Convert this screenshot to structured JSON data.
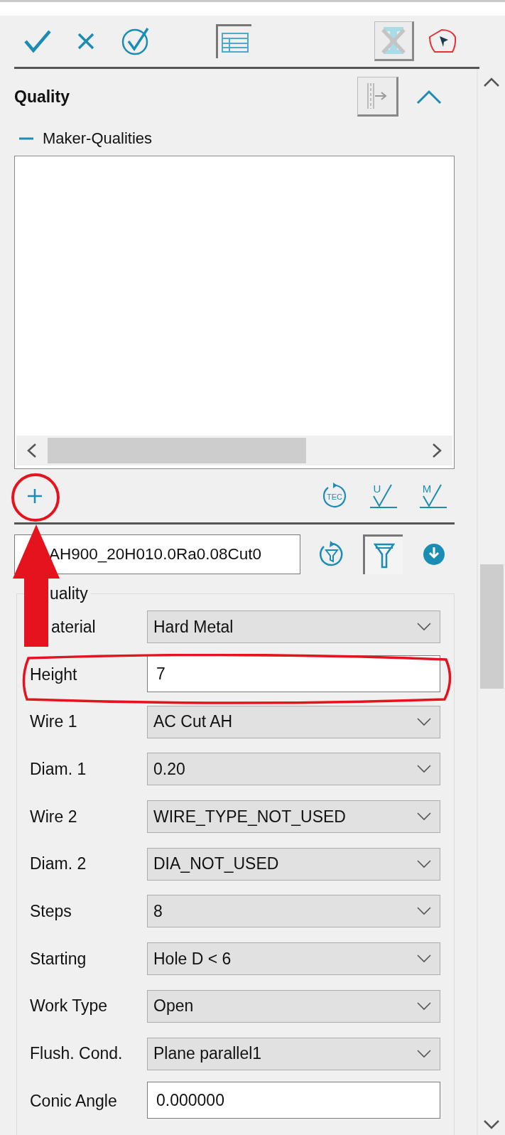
{
  "toolbar": [
    {
      "kind": "accept",
      "pressed": false
    },
    {
      "kind": "cancel",
      "pressed": false
    },
    {
      "kind": "apply",
      "pressed": false
    },
    {
      "kind": "table",
      "pressed": true
    },
    {
      "kind": "clear",
      "pressed": false
    },
    {
      "kind": "contour",
      "pressed": false
    }
  ],
  "section": {
    "title": "Quality",
    "expanded": true
  },
  "maker_qualities": {
    "label": "Maker-Qualities",
    "expanded": true
  },
  "tool_buttons": [
    {
      "kind": "tec",
      "text": "TEC"
    },
    {
      "kind": "check",
      "text": "U"
    },
    {
      "kind": "check",
      "text": "M"
    }
  ],
  "quality_field": {
    "value": "AH900_20H010.0Ra0.08Cut0"
  },
  "filter_buttons": [
    {
      "kind": "reset-filter",
      "pressed": false
    },
    {
      "kind": "filter",
      "pressed": true
    },
    {
      "kind": "download",
      "pressed": false
    }
  ],
  "group": {
    "title": "uality",
    "rows": [
      {
        "label": "aterial",
        "kind": "combo",
        "value": "Hard Metal"
      },
      {
        "label": "Height",
        "kind": "input",
        "value": "7"
      },
      {
        "label": "Wire 1",
        "kind": "combo",
        "value": "AC Cut AH"
      },
      {
        "label": "Diam. 1",
        "kind": "combo",
        "value": "0.20"
      },
      {
        "label": "Wire 2",
        "kind": "combo",
        "value": "WIRE_TYPE_NOT_USED"
      },
      {
        "label": "Diam. 2",
        "kind": "combo",
        "value": "DIA_NOT_USED"
      },
      {
        "label": "Steps",
        "kind": "combo",
        "value": "8"
      },
      {
        "label": "Starting",
        "kind": "combo",
        "value": "Hole D < 6"
      },
      {
        "label": "Work Type",
        "kind": "combo",
        "value": "Open"
      },
      {
        "label": "Flush. Cond.",
        "kind": "combo",
        "value": "Plane parallel1"
      },
      {
        "label": "Conic Angle",
        "kind": "input",
        "value": "0.000000"
      }
    ]
  }
}
